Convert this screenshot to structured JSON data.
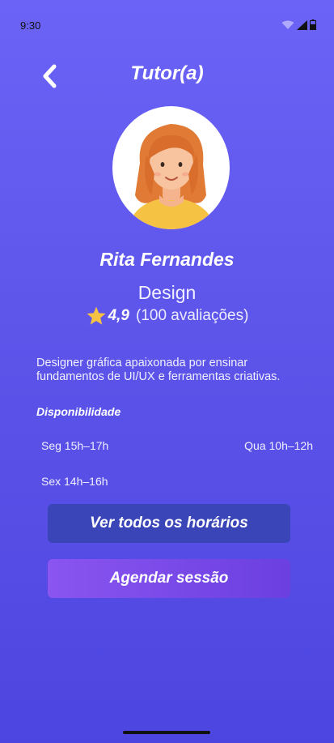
{
  "status_bar": {
    "time": "9:30",
    "icons": [
      "wifi-icon",
      "cellular-signal-icon",
      "battery-icon"
    ]
  },
  "header": {
    "title": "Tutor(a)",
    "back_icon": "chevron-left-icon"
  },
  "tutor": {
    "avatar": "tutor-avatar-illustration",
    "name": "Rita Fernandes",
    "subject": "Design",
    "rating": "4,9",
    "rating_count": "(100 avaliações)",
    "bio": "Designer gráfica apaixonada por ensinar fundamentos de UI/UX e ferramentas criativas."
  },
  "availability": {
    "title": "Disponibilidade",
    "slots": [
      "Seg 15h–17h",
      "Qua 10h–12h",
      "Sex 14h–16h"
    ]
  },
  "actions": {
    "view_all_label": "Ver todos os horários",
    "book_label": "Agendar sessão"
  },
  "colors": {
    "background_top": "#6b63f6",
    "background_bottom": "#4d45df",
    "star": "#f6c244",
    "secondary_button": "#3a45b8",
    "primary_button": "#7b4ae8"
  }
}
